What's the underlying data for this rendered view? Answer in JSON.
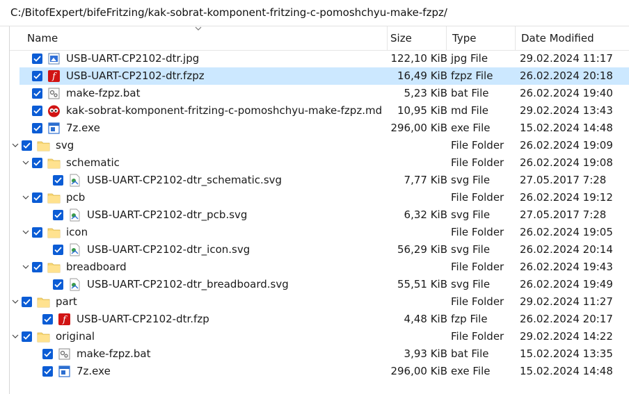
{
  "path": "C:/BitofExpert/bifeFritzing/kak-sobrat-komponent-fritzing-c-pomoshchyu-make-fzpz/",
  "columns": {
    "name": "Name",
    "size": "Size",
    "type": "Type",
    "date": "Date Modified"
  },
  "rows": [
    {
      "name": "USB-UART-CP2102-dtr.jpg",
      "size": "122,10 KiB",
      "type": "jpg File",
      "date": "29.02.2024 11:17",
      "level": 0,
      "icon": "image-file-icon",
      "expand": "",
      "selected": false
    },
    {
      "name": "USB-UART-CP2102-dtr.fzpz",
      "size": "16,49 KiB",
      "type": "fzpz File",
      "date": "26.02.2024 20:18",
      "level": 0,
      "icon": "fritzing-file-icon",
      "expand": "",
      "selected": true
    },
    {
      "name": "make-fzpz.bat",
      "size": "5,23 KiB",
      "type": "bat File",
      "date": "26.02.2024 19:40",
      "level": 0,
      "icon": "batch-file-icon",
      "expand": "",
      "selected": false
    },
    {
      "name": "kak-sobrat-komponent-fritzing-c-pomoshchyu-make-fzpz.md",
      "size": "10,95 KiB",
      "type": "md File",
      "date": "29.02.2024 13:43",
      "level": 0,
      "icon": "markdown-file-icon",
      "expand": "",
      "selected": false
    },
    {
      "name": "7z.exe",
      "size": "296,00 KiB",
      "type": "exe File",
      "date": "15.02.2024 14:48",
      "level": 0,
      "icon": "exe-file-icon",
      "expand": "",
      "selected": false
    },
    {
      "name": "svg",
      "size": "",
      "type": "File Folder",
      "date": "26.02.2024 19:09",
      "level": 0,
      "icon": "folder-icon",
      "expand": "open",
      "selected": false
    },
    {
      "name": "schematic",
      "size": "",
      "type": "File Folder",
      "date": "26.02.2024 19:08",
      "level": 1,
      "icon": "folder-icon",
      "expand": "open",
      "selected": false
    },
    {
      "name": "USB-UART-CP2102-dtr_schematic.svg",
      "size": "7,77 KiB",
      "type": "svg File",
      "date": "27.05.2017 7:28",
      "level": 2,
      "icon": "svg-file-icon",
      "expand": "",
      "selected": false
    },
    {
      "name": "pcb",
      "size": "",
      "type": "File Folder",
      "date": "26.02.2024 19:12",
      "level": 1,
      "icon": "folder-icon",
      "expand": "open",
      "selected": false
    },
    {
      "name": "USB-UART-CP2102-dtr_pcb.svg",
      "size": "6,32 KiB",
      "type": "svg File",
      "date": "27.05.2017 7:28",
      "level": 2,
      "icon": "svg-file-icon",
      "expand": "",
      "selected": false
    },
    {
      "name": "icon",
      "size": "",
      "type": "File Folder",
      "date": "26.02.2024 19:05",
      "level": 1,
      "icon": "folder-icon",
      "expand": "open",
      "selected": false
    },
    {
      "name": "USB-UART-CP2102-dtr_icon.svg",
      "size": "56,29 KiB",
      "type": "svg File",
      "date": "26.02.2024 20:14",
      "level": 2,
      "icon": "svg-file-icon",
      "expand": "",
      "selected": false
    },
    {
      "name": "breadboard",
      "size": "",
      "type": "File Folder",
      "date": "26.02.2024 19:43",
      "level": 1,
      "icon": "folder-icon",
      "expand": "open",
      "selected": false
    },
    {
      "name": "USB-UART-CP2102-dtr_breadboard.svg",
      "size": "55,51 KiB",
      "type": "svg File",
      "date": "26.02.2024 19:49",
      "level": 2,
      "icon": "svg-file-icon",
      "expand": "",
      "selected": false
    },
    {
      "name": "part",
      "size": "",
      "type": "File Folder",
      "date": "29.02.2024 11:27",
      "level": 0,
      "icon": "folder-icon",
      "expand": "open",
      "selected": false
    },
    {
      "name": "USB-UART-CP2102-dtr.fzp",
      "size": "4,48 KiB",
      "type": "fzp File",
      "date": "26.02.2024 20:17",
      "level": 1,
      "icon": "fritzing-file-icon",
      "expand": "",
      "selected": false
    },
    {
      "name": "original",
      "size": "",
      "type": "File Folder",
      "date": "29.02.2024 14:22",
      "level": 0,
      "icon": "folder-icon",
      "expand": "open",
      "selected": false
    },
    {
      "name": "make-fzpz.bat",
      "size": "3,93 KiB",
      "type": "bat File",
      "date": "15.02.2024 13:35",
      "level": 1,
      "icon": "batch-file-icon",
      "expand": "",
      "selected": false
    },
    {
      "name": "7z.exe",
      "size": "296,00 KiB",
      "type": "exe File",
      "date": "15.02.2024 14:48",
      "level": 1,
      "icon": "exe-file-icon",
      "expand": "",
      "selected": false
    }
  ],
  "colors": {
    "accent": "#0b5cd5",
    "selection": "#cce8ff",
    "folder": "#f8d775"
  }
}
